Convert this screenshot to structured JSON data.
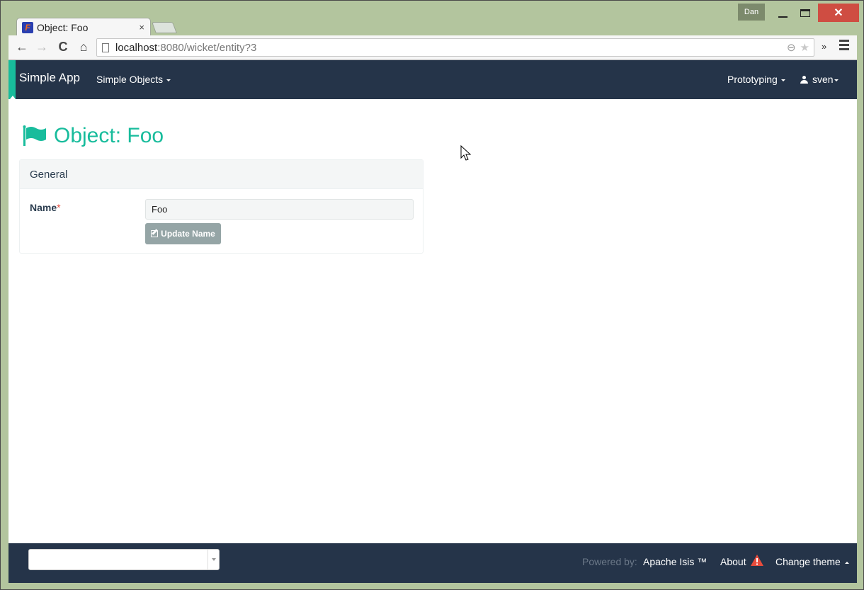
{
  "window": {
    "user": "Dan",
    "controls": {
      "minimize": "minimize",
      "maximize": "maximize",
      "close": "✕"
    }
  },
  "browser": {
    "tab": {
      "title": "Object: Foo",
      "close": "×",
      "favicon": "F"
    },
    "url": {
      "host": "localhost",
      "rest": ":8080/wicket/entity?3"
    },
    "icons": {
      "back": "←",
      "forward": "→",
      "reload": "C",
      "home": "⌂",
      "zoom": "⊖",
      "star": "★",
      "extensions": "»"
    }
  },
  "navbar": {
    "brand": "Simple App",
    "left_menu": [
      {
        "label": "Simple Objects"
      }
    ],
    "right_menu": [
      {
        "label": "Prototyping"
      },
      {
        "label": "sven"
      }
    ],
    "accent": "#18bc9c",
    "background": "#253449"
  },
  "page": {
    "title": "Object: Foo",
    "panel": {
      "heading": "General",
      "fields": [
        {
          "label": "Name",
          "required_marker": "*",
          "value": "Foo"
        }
      ],
      "actions": [
        {
          "label": "Update Name"
        }
      ]
    }
  },
  "footer": {
    "theme_select": {
      "value": "",
      "arrow": "▾"
    },
    "powered_by": "Powered by:",
    "isis_link": "Apache Isis ™",
    "about": "About",
    "change_theme": "Change theme"
  }
}
